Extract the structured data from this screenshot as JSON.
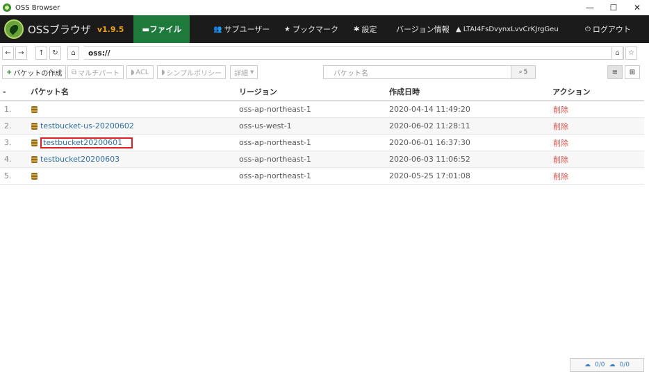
{
  "window": {
    "title": "OSS Browser",
    "minimize": "—",
    "maximize": "☐",
    "close": "✕"
  },
  "nav": {
    "brand": "OSSブラウザ",
    "version": "v1.9.5",
    "file": "ファイル",
    "subusers": "サブユーザー",
    "bookmarks": "ブックマーク",
    "settings": "設定",
    "version_info": "バージョン情報",
    "account": "LTAI4FsDvynxLvvCrKJrgGeu",
    "logout": "ログアウト"
  },
  "address": {
    "path": "oss://"
  },
  "toolbar": {
    "create_bucket": "バケットの作成",
    "multipart": "マルチパート",
    "acl": "ACL",
    "simple_policy": "シンプルポリシー",
    "details": "詳細",
    "search_placeholder": "バケット名",
    "search_count": "5"
  },
  "table": {
    "headers": {
      "idx": "-",
      "name": "バケット名",
      "region": "リージョン",
      "created": "作成日時",
      "action": "アクション"
    },
    "rows": [
      {
        "idx": "1.",
        "name": "",
        "region": "oss-ap-northeast-1",
        "created": "2020-04-14 11:49:20",
        "action": "削除"
      },
      {
        "idx": "2.",
        "name": "testbucket-us-20200602",
        "region": "oss-us-west-1",
        "created": "2020-06-02 11:28:11",
        "action": "削除"
      },
      {
        "idx": "3.",
        "name": "testbucket20200601",
        "region": "oss-ap-northeast-1",
        "created": "2020-06-01 16:37:30",
        "action": "削除"
      },
      {
        "idx": "4.",
        "name": "testbucket20200603",
        "region": "oss-ap-northeast-1",
        "created": "2020-06-03 11:06:52",
        "action": "削除"
      },
      {
        "idx": "5.",
        "name": "",
        "region": "oss-ap-northeast-1",
        "created": "2020-05-25 17:01:08",
        "action": "削除"
      }
    ]
  },
  "status": {
    "upload": "0/0",
    "download": "0/0"
  },
  "colors": {
    "nav_bg": "#1b1b1b",
    "file_active": "#1d7a3a",
    "version": "#f0a010",
    "link": "#2e6da4",
    "delete": "#d9534f",
    "highlight": "#e02020"
  }
}
